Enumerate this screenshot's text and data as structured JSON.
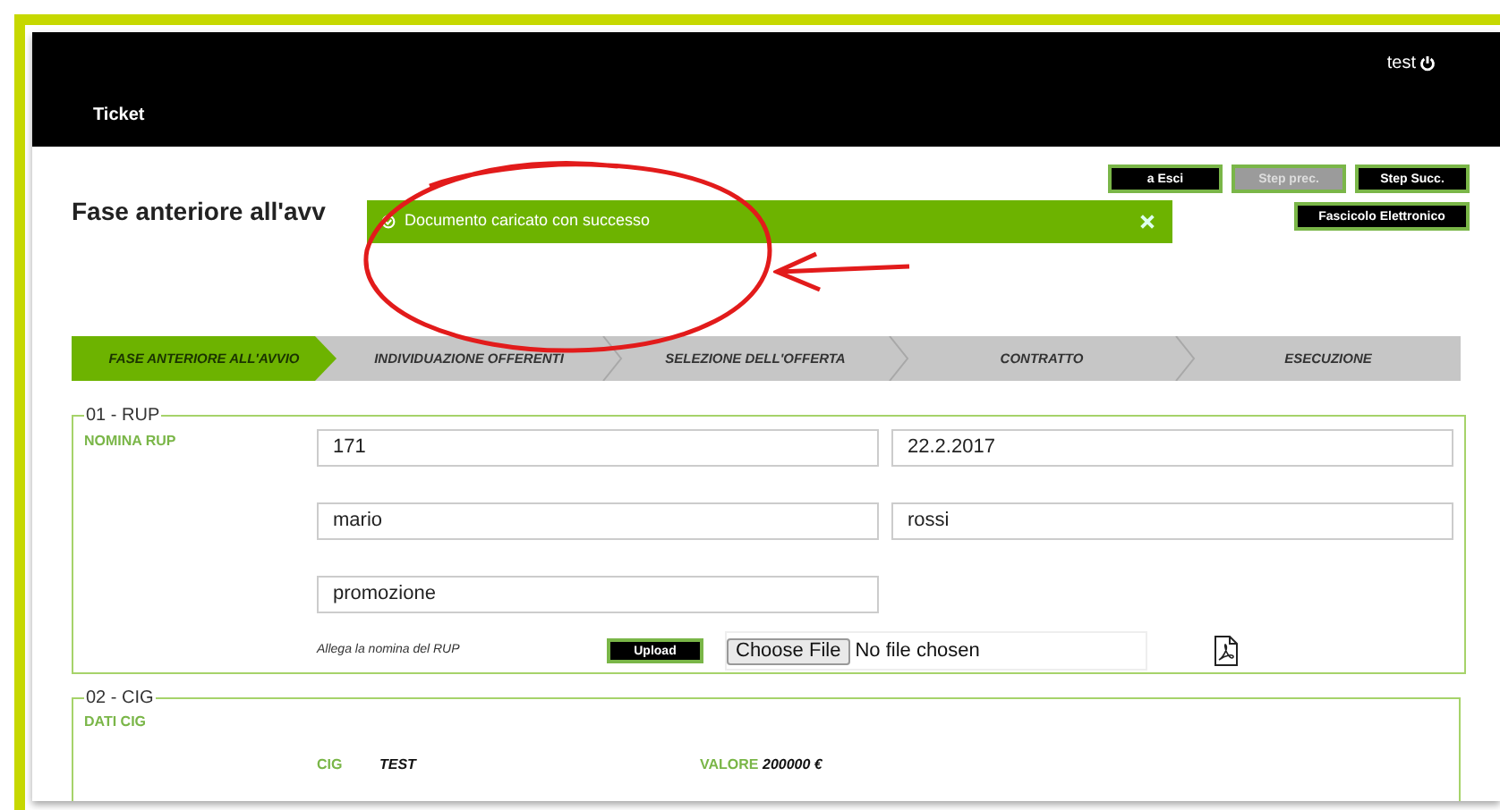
{
  "header": {
    "user": "test",
    "nav": "Ticket"
  },
  "page_title": "Fase anteriore all'avv",
  "toast": {
    "message": "Documento caricato con successo"
  },
  "buttons": [
    {
      "label": "a Esci",
      "disabled": false
    },
    {
      "label": "Step prec.",
      "disabled": true
    },
    {
      "label": "Step Succ.",
      "disabled": false
    },
    {
      "label": "Fascicolo Elettronico",
      "disabled": false
    }
  ],
  "steps": [
    {
      "label": "FASE ANTERIORE ALL'AVVIO",
      "selected": true
    },
    {
      "label": "INDIVIDUAZIONE OFFERENTI",
      "selected": false
    },
    {
      "label": "SELEZIONE DELL'OFFERTA",
      "selected": false
    },
    {
      "label": "CONTRATTO",
      "selected": false
    },
    {
      "label": "ESECUZIONE",
      "selected": false
    }
  ],
  "rup": {
    "legend": "01 - RUP",
    "label": "NOMINA RUP",
    "fields": [
      "171",
      "22.2.2017",
      "mario",
      "rossi",
      "promozione"
    ],
    "attach_label": "Allega la nomina del RUP",
    "upload": "Upload",
    "file_button": "Choose File",
    "file_status": "No file chosen"
  },
  "cig": {
    "legend": "02 - CIG",
    "label": "DATI CIG",
    "items": [
      {
        "label": "CIG",
        "value": "TEST"
      },
      {
        "label": "VALORE",
        "value": "200000 €"
      }
    ]
  }
}
